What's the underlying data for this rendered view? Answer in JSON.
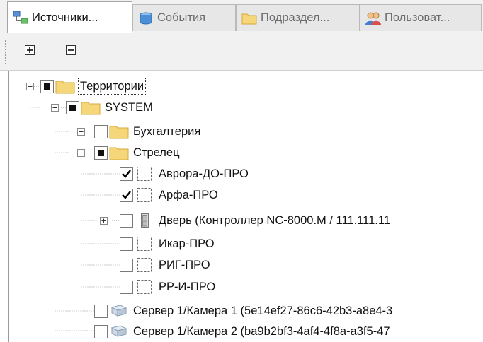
{
  "tabs": [
    {
      "label": "Источники...",
      "icon": "sources-icon",
      "active": true
    },
    {
      "label": "События",
      "icon": "events-icon",
      "active": false
    },
    {
      "label": "Подраздел...",
      "icon": "folder-icon",
      "active": false
    },
    {
      "label": "Пользоват...",
      "icon": "users-icon",
      "active": false
    }
  ],
  "toolbar": {
    "expand_all": "expand-all-icon",
    "collapse_all": "collapse-all-icon"
  },
  "tree": {
    "root": {
      "label": "Территории",
      "check": "indeterminate",
      "icon": "folder-icon"
    },
    "system": {
      "label": "SYSTEM",
      "check": "indeterminate",
      "icon": "folder-icon"
    },
    "buh": {
      "label": "Бухгалтерия",
      "check": "unchecked",
      "icon": "folder-icon"
    },
    "strelets": {
      "label": "Стрелец",
      "check": "indeterminate",
      "icon": "folder-icon"
    },
    "items": [
      {
        "label": "Аврора-ДО-ПРО",
        "check": "checked",
        "icon": "device-placeholder-icon"
      },
      {
        "label": "Арфа-ПРО",
        "check": "checked",
        "icon": "device-placeholder-icon"
      },
      {
        "label": "Дверь (Контроллер NC-8000.M / 111.111.11",
        "check": "unchecked",
        "icon": "door-icon"
      },
      {
        "label": "Икар-ПРО",
        "check": "unchecked",
        "icon": "device-placeholder-icon"
      },
      {
        "label": "РИГ-ПРО",
        "check": "unchecked",
        "icon": "device-placeholder-icon"
      },
      {
        "label": "РР-И-ПРО",
        "check": "unchecked",
        "icon": "device-placeholder-icon"
      }
    ],
    "cameras": [
      {
        "label": "Сервер 1/Камера 1 (5e14ef27-86c6-42b3-a8e4-3",
        "check": "unchecked",
        "icon": "camera-icon"
      },
      {
        "label": "Сервер 1/Камера 2 (ba9b2bf3-4af4-4f8a-a3f5-47",
        "check": "unchecked",
        "icon": "camera-icon"
      }
    ]
  },
  "colors": {
    "folder": "#f5d77a",
    "folder_edge": "#d6a93a",
    "accent": "#2a6cc8"
  }
}
